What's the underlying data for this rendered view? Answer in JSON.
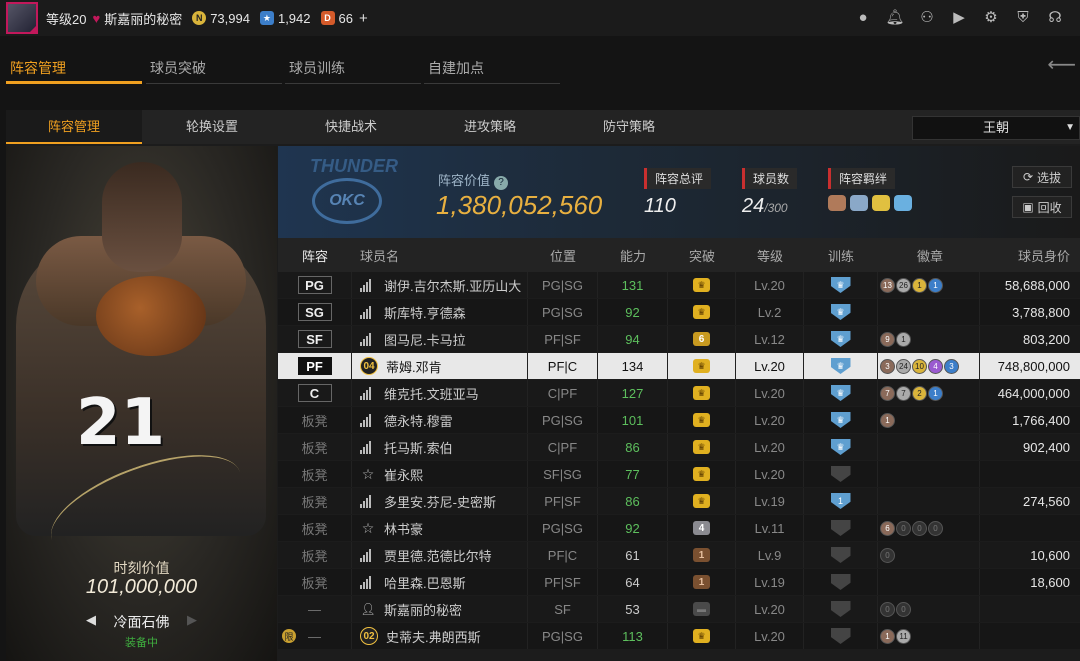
{
  "topbar": {
    "level_text": "等级20",
    "username": "斯嘉丽的秘密",
    "gold": "73,994",
    "points": "1,942",
    "tickets": "66",
    "plus": "+",
    "icons": [
      "person-icon",
      "bell-icon",
      "friends-icon",
      "video-icon",
      "gear-icon",
      "shield-settings-icon",
      "headset-icon"
    ]
  },
  "tabs": [
    "阵容管理",
    "球员突破",
    "球员训练",
    "自建加点"
  ],
  "subtabs": [
    "阵容管理",
    "轮换设置",
    "快捷战术",
    "进攻策略",
    "防守策略"
  ],
  "team_select": "王朝",
  "card": {
    "jersey_number": "21",
    "moment_label": "时刻价值",
    "moment_value": "101,000,000",
    "card_name": "冷面石佛",
    "status": "装备中"
  },
  "info": {
    "logo_text": "THUNDER",
    "logo_badge": "OKC",
    "lineup_value_label": "阵容价值",
    "lineup_value": "1,380,052,560",
    "rating_label": "阵容总评",
    "rating": "110",
    "player_count_label": "球员数",
    "player_count": "24",
    "player_count_max": "/300",
    "bond_label": "阵容羁绊",
    "scout_button": "选拔",
    "recycle_button": "回收"
  },
  "table": {
    "headers": [
      "阵容",
      "球员名",
      "位置",
      "能力",
      "突破",
      "等级",
      "训练",
      "徽章",
      "球员身价"
    ],
    "rows": [
      {
        "slot": "PG",
        "name": "谢伊.吉尔杰斯.亚历山大",
        "pos": "PG|SG",
        "ovr": "131",
        "brk": "crown",
        "lvl": "Lv.20",
        "train": "shield",
        "badges": [
          [
            "b",
            "13"
          ],
          [
            "s",
            "26"
          ],
          [
            "g",
            "1"
          ],
          [
            "d",
            "1"
          ]
        ],
        "value": "58,688,000"
      },
      {
        "slot": "SG",
        "name": "斯库特.亨德森",
        "pos": "PG|SG",
        "ovr": "92",
        "brk": "crown",
        "lvl": "Lv.2",
        "train": "shield",
        "badges": [],
        "value": "3,788,800"
      },
      {
        "slot": "SF",
        "name": "图马尼.卡马拉",
        "pos": "PF|SF",
        "ovr": "94",
        "brk": "6",
        "lvl": "Lv.12",
        "train": "shield",
        "badges": [
          [
            "b",
            "9"
          ],
          [
            "s",
            "1"
          ]
        ],
        "value": "803,200"
      },
      {
        "slot": "PF",
        "name": "蒂姆.邓肯",
        "pos": "PF|C",
        "ovr": "134",
        "brk": "crown",
        "lvl": "Lv.20",
        "train": "shield",
        "badges": [
          [
            "b",
            "3"
          ],
          [
            "s",
            "24"
          ],
          [
            "g",
            "10"
          ],
          [
            "p",
            "4"
          ],
          [
            "d",
            "3"
          ]
        ],
        "value": "748,800,000",
        "num_badge": "04",
        "selected": true
      },
      {
        "slot": "C",
        "name": "维克托.文班亚马",
        "pos": "C|PF",
        "ovr": "127",
        "brk": "crown",
        "lvl": "Lv.20",
        "train": "shield",
        "badges": [
          [
            "b",
            "7"
          ],
          [
            "s",
            "7"
          ],
          [
            "g",
            "2"
          ],
          [
            "d",
            "1"
          ]
        ],
        "value": "464,000,000"
      },
      {
        "slot": "板凳",
        "name": "德永特.穆雷",
        "pos": "PG|SG",
        "ovr": "101",
        "brk": "crown",
        "lvl": "Lv.20",
        "train": "shield",
        "badges": [
          [
            "b",
            "1"
          ]
        ],
        "value": "1,766,400"
      },
      {
        "slot": "板凳",
        "name": "托马斯.索伯",
        "pos": "C|PF",
        "ovr": "86",
        "brk": "crown",
        "lvl": "Lv.20",
        "train": "shield",
        "badges": [],
        "value": "902,400"
      },
      {
        "slot": "板凳",
        "name": "崔永熙",
        "pos": "SF|SG",
        "ovr": "77",
        "brk": "crown",
        "lvl": "Lv.20",
        "train": "dim",
        "badges": [],
        "value": "",
        "star": true
      },
      {
        "slot": "板凳",
        "name": "多里安.芬尼-史密斯",
        "pos": "PF|SF",
        "ovr": "86",
        "brk": "crown",
        "lvl": "Lv.19",
        "train": "shield1",
        "badges": [],
        "value": "274,560"
      },
      {
        "slot": "板凳",
        "name": "林书豪",
        "pos": "PG|SG",
        "ovr": "92",
        "brk": "4",
        "lvl": "Lv.11",
        "train": "dim",
        "badges": [
          [
            "b",
            "6"
          ],
          [
            "x",
            "0"
          ],
          [
            "x",
            "0"
          ],
          [
            "x",
            "0"
          ]
        ],
        "value": "",
        "star": true
      },
      {
        "slot": "板凳",
        "name": "贾里德.范德比尔特",
        "pos": "PF|C",
        "ovr": "61",
        "brk": "1",
        "lvl": "Lv.9",
        "train": "dim",
        "badges": [
          [
            "x",
            "0"
          ]
        ],
        "value": "10,600"
      },
      {
        "slot": "板凳",
        "name": "哈里森.巴恩斯",
        "pos": "PF|SF",
        "ovr": "64",
        "brk": "1",
        "lvl": "Lv.19",
        "train": "dim",
        "badges": [],
        "value": "18,600"
      },
      {
        "slot": "—",
        "name": "斯嘉丽的秘密",
        "pos": "SF",
        "ovr": "53",
        "brk": "dark",
        "lvl": "Lv.20",
        "train": "dim",
        "badges": [
          [
            "x",
            "0"
          ],
          [
            "x",
            "0"
          ]
        ],
        "value": "",
        "person": true
      },
      {
        "slot": "—",
        "name": "史蒂夫.弗朗西斯",
        "pos": "PG|SG",
        "ovr": "113",
        "brk": "crown",
        "lvl": "Lv.20",
        "train": "dim",
        "badges": [
          [
            "b",
            "1"
          ],
          [
            "s",
            "11"
          ]
        ],
        "value": "",
        "num_badge": "02",
        "limited": "限"
      }
    ]
  },
  "colors": {
    "accent": "#f0a020",
    "ability_green": "#5dbf5d",
    "selected_row": "#e8e8e8"
  }
}
